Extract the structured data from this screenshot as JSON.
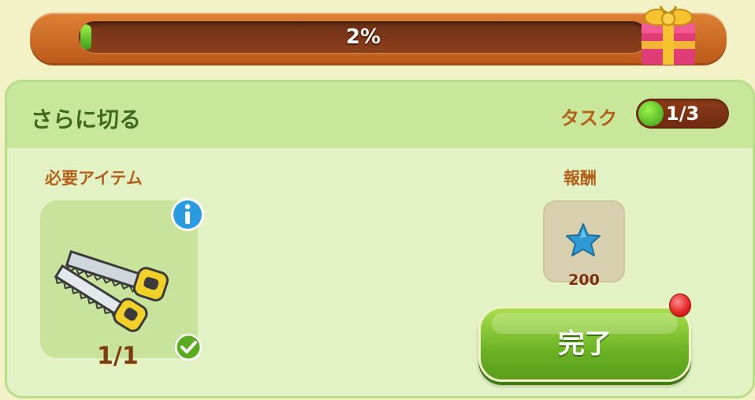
{
  "progress": {
    "percent_label": "2%",
    "percent": 2
  },
  "quest": {
    "title": "さらに切る",
    "task_label": "タスク",
    "task_count": "1/3"
  },
  "required": {
    "label": "必要アイテム",
    "item_icon": "hand-saw-icon",
    "count": "1/1"
  },
  "reward": {
    "label": "報酬",
    "icon": "blue-star-icon",
    "amount": "200"
  },
  "complete_button": {
    "label": "完了"
  },
  "colors": {
    "banner": "#c9662a",
    "panel_bg": "#e2f2c4",
    "header_bg": "#c8e79a",
    "accent_green": "#6bb224",
    "label_brown": "#b3611a"
  }
}
